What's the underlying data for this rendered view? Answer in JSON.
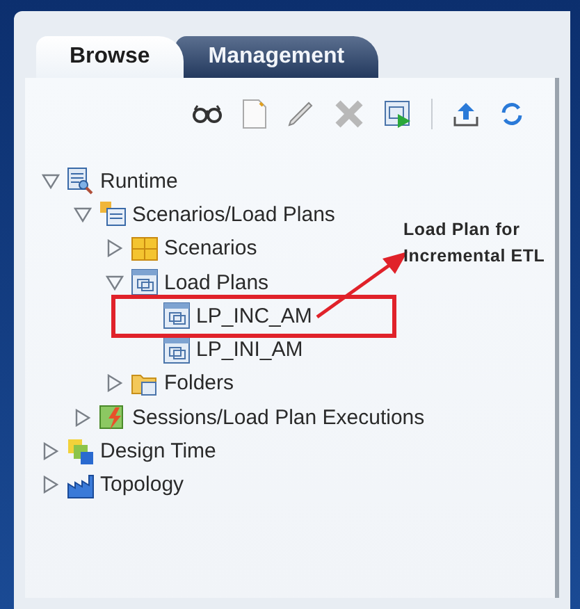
{
  "tabs": [
    {
      "label": "Browse",
      "selected": true
    },
    {
      "label": "Management",
      "selected": false
    }
  ],
  "tree": [
    {
      "label": "Runtime",
      "kind": "runtime",
      "expanded": true,
      "children": [
        {
          "label": "Scenarios/Load Plans",
          "kind": "package",
          "expanded": true,
          "children": [
            {
              "label": "Scenarios",
              "kind": "grid",
              "expanded": false
            },
            {
              "label": "Load Plans",
              "kind": "plans",
              "expanded": true,
              "children": [
                {
                  "label": "LP_INC_AM",
                  "kind": "plan"
                },
                {
                  "label": "LP_INI_AM",
                  "kind": "plan"
                }
              ]
            },
            {
              "label": "Folders",
              "kind": "folder",
              "expanded": false
            }
          ]
        },
        {
          "label": "Sessions/Load Plan Executions",
          "kind": "sessions",
          "expanded": false
        }
      ]
    },
    {
      "label": "Design Time",
      "kind": "design",
      "expanded": false
    },
    {
      "label": "Topology",
      "kind": "topology",
      "expanded": false
    }
  ],
  "annotation": {
    "lines": [
      "Load Plan for",
      "Incremental ETL"
    ]
  }
}
